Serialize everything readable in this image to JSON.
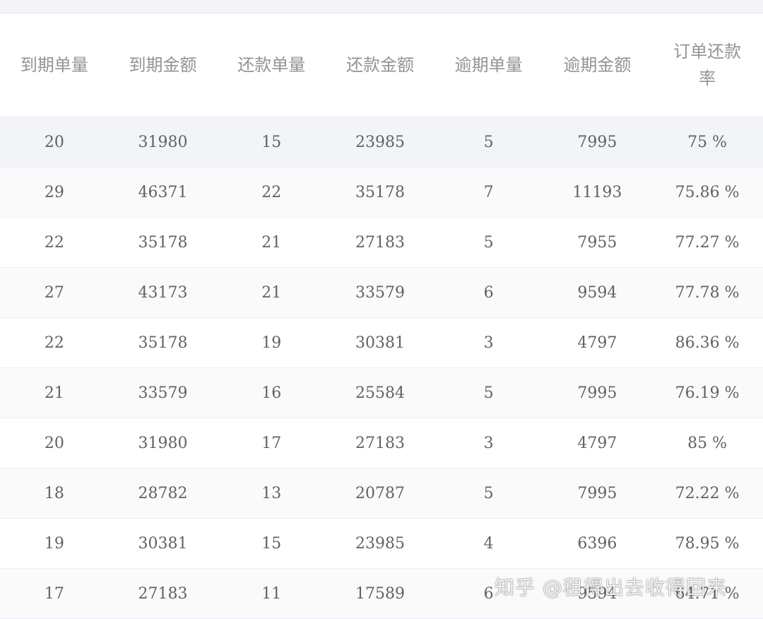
{
  "table": {
    "headers": [
      "到期单量",
      "到期金额",
      "还款单量",
      "还款金额",
      "逾期单量",
      "逾期金额",
      "订单还款率"
    ],
    "rows": [
      [
        "20",
        "31980",
        "15",
        "23985",
        "5",
        "7995",
        "75 %"
      ],
      [
        "29",
        "46371",
        "22",
        "35178",
        "7",
        "11193",
        "75.86 %"
      ],
      [
        "22",
        "35178",
        "21",
        "27183",
        "5",
        "7955",
        "77.27 %"
      ],
      [
        "27",
        "43173",
        "21",
        "33579",
        "6",
        "9594",
        "77.78 %"
      ],
      [
        "22",
        "35178",
        "19",
        "30381",
        "3",
        "4797",
        "86.36 %"
      ],
      [
        "21",
        "33579",
        "16",
        "25584",
        "5",
        "7995",
        "76.19 %"
      ],
      [
        "20",
        "31980",
        "17",
        "27183",
        "3",
        "4797",
        "85 %"
      ],
      [
        "18",
        "28782",
        "13",
        "20787",
        "5",
        "7995",
        "72.22 %"
      ],
      [
        "19",
        "30381",
        "15",
        "23985",
        "4",
        "6396",
        "78.95 %"
      ],
      [
        "17",
        "27183",
        "11",
        "17589",
        "6",
        "9594",
        "64.71 %"
      ]
    ]
  },
  "watermark": {
    "text": "知乎 @租得出去收得回来"
  },
  "colors": {
    "header_text": "#909399",
    "cell_text": "#606266",
    "row_hover": "#f2f4f8",
    "row_striped": "#fafafa",
    "border": "#ebeef5"
  }
}
